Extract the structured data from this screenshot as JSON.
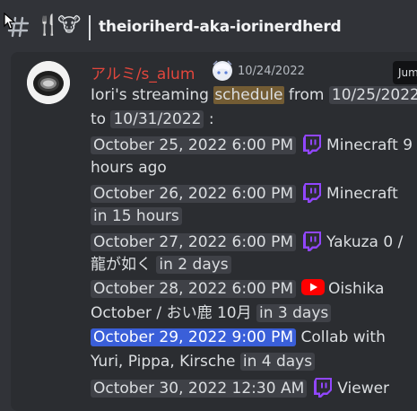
{
  "header": {
    "emoji_fork_knife": "🍴",
    "emoji_cow": "🐮",
    "channel_name": "theioriherd-aka-iorinerdherd"
  },
  "message": {
    "author": "アルミ/s_alum",
    "timestamp": "10/24/2022",
    "jump_label": "Jum",
    "intro": {
      "prefix": "Iori's streaming ",
      "keyword": "schedule",
      "from_word": " from ",
      "start_date": "10/25/2022",
      "to_word": "to ",
      "end_date": "10/31/2022",
      "colon": " :"
    },
    "entries": [
      {
        "datetime": "October 25, 2022 6:00 PM",
        "platform": "twitch",
        "title": "Minecraft",
        "relative_a": "9",
        "relative_b": "hours ago"
      },
      {
        "datetime": "October 26, 2022 6:00 PM",
        "platform": "twitch",
        "title": "Minecraft",
        "relative": "in 15 hours"
      },
      {
        "datetime": "October 27, 2022 6:00 PM",
        "platform": "twitch",
        "title": "Yakuza 0 /",
        "title_2": "龍が如く",
        "relative": "in 2 days"
      },
      {
        "datetime": "October 28, 2022 6:00 PM",
        "platform": "youtube",
        "title": "Oishika",
        "title_2": "October / おい鹿 10月",
        "relative": "in 3 days"
      },
      {
        "datetime": "October 29, 2022 9:00 PM",
        "platform": "none",
        "title": "Collab with",
        "title_2": "Yuri, Pippa, Kirsche",
        "relative": "in 4 days"
      },
      {
        "datetime": "October 30, 2022 12:30 AM",
        "platform": "twitch",
        "title": "Viewer"
      }
    ]
  },
  "colors": {
    "background": "#313338",
    "panel": "#2b2d31",
    "author": "#e2463c",
    "pill": "#3f4147",
    "pill_selected": "#3a5fd9",
    "twitch": "#9146ff",
    "youtube": "#ff0000",
    "search_highlight": "#735c34"
  }
}
